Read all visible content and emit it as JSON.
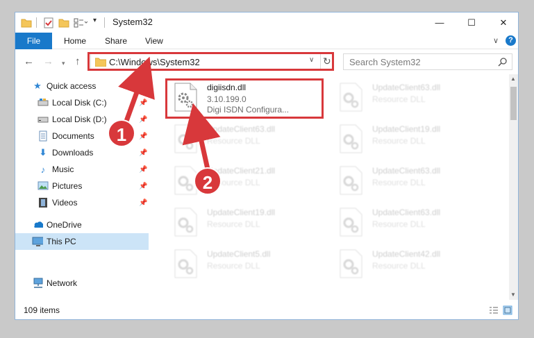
{
  "window": {
    "title": "System32",
    "minimize_glyph": "—",
    "maximize_glyph": "☐",
    "close_glyph": "✕"
  },
  "ribbon": {
    "tabs": [
      "File",
      "Home",
      "Share",
      "View"
    ]
  },
  "address_bar": {
    "path": "C:\\Windows\\System32",
    "search_placeholder": "Search System32"
  },
  "nav_pane": {
    "items": [
      {
        "label": "Quick access",
        "icon": "star-icon",
        "pinned": false
      },
      {
        "label": "Local Disk (C:)",
        "icon": "drive-icon",
        "pinned": true
      },
      {
        "label": "Local Disk (D:)",
        "icon": "drive-icon",
        "pinned": true
      },
      {
        "label": "Documents",
        "icon": "documents-icon",
        "pinned": true
      },
      {
        "label": "Downloads",
        "icon": "download-icon",
        "pinned": true
      },
      {
        "label": "Music",
        "icon": "music-icon",
        "pinned": true
      },
      {
        "label": "Pictures",
        "icon": "pictures-icon",
        "pinned": true
      },
      {
        "label": "Videos",
        "icon": "videos-icon",
        "pinned": true
      },
      {
        "label": "OneDrive",
        "icon": "cloud-icon",
        "pinned": false
      },
      {
        "label": "This PC",
        "icon": "computer-icon",
        "pinned": false,
        "selected": true
      },
      {
        "label": "Network",
        "icon": "network-icon",
        "pinned": false
      }
    ]
  },
  "files": {
    "highlighted": {
      "name": "digiisdn.dll",
      "version": "3.10.199.0",
      "description": "Digi ISDN Configura..."
    },
    "left_column": [
      {
        "name": "UpdateClient63.dll",
        "type": "Resource DLL"
      },
      {
        "name": "UpdateClient21.dll",
        "type": "Resource DLL"
      },
      {
        "name": "UpdateClient19.dll",
        "type": "Resource DLL"
      },
      {
        "name": "UpdateClient5.dll",
        "type": "Resource DLL"
      }
    ],
    "right_column": [
      {
        "name": "UpdateClient63.dll",
        "type": "Resource DLL"
      },
      {
        "name": "UpdateClient19.dll",
        "type": "Resource DLL"
      },
      {
        "name": "UpdateClient63.dll",
        "type": "Resource DLL"
      },
      {
        "name": "UpdateClient63.dll",
        "type": "Resource DLL"
      },
      {
        "name": "UpdateClient42.dll",
        "type": "Resource DLL"
      }
    ]
  },
  "status_bar": {
    "item_count": "109 items"
  },
  "annotations": {
    "step1": "1",
    "step2": "2",
    "color": "#d8383b"
  }
}
